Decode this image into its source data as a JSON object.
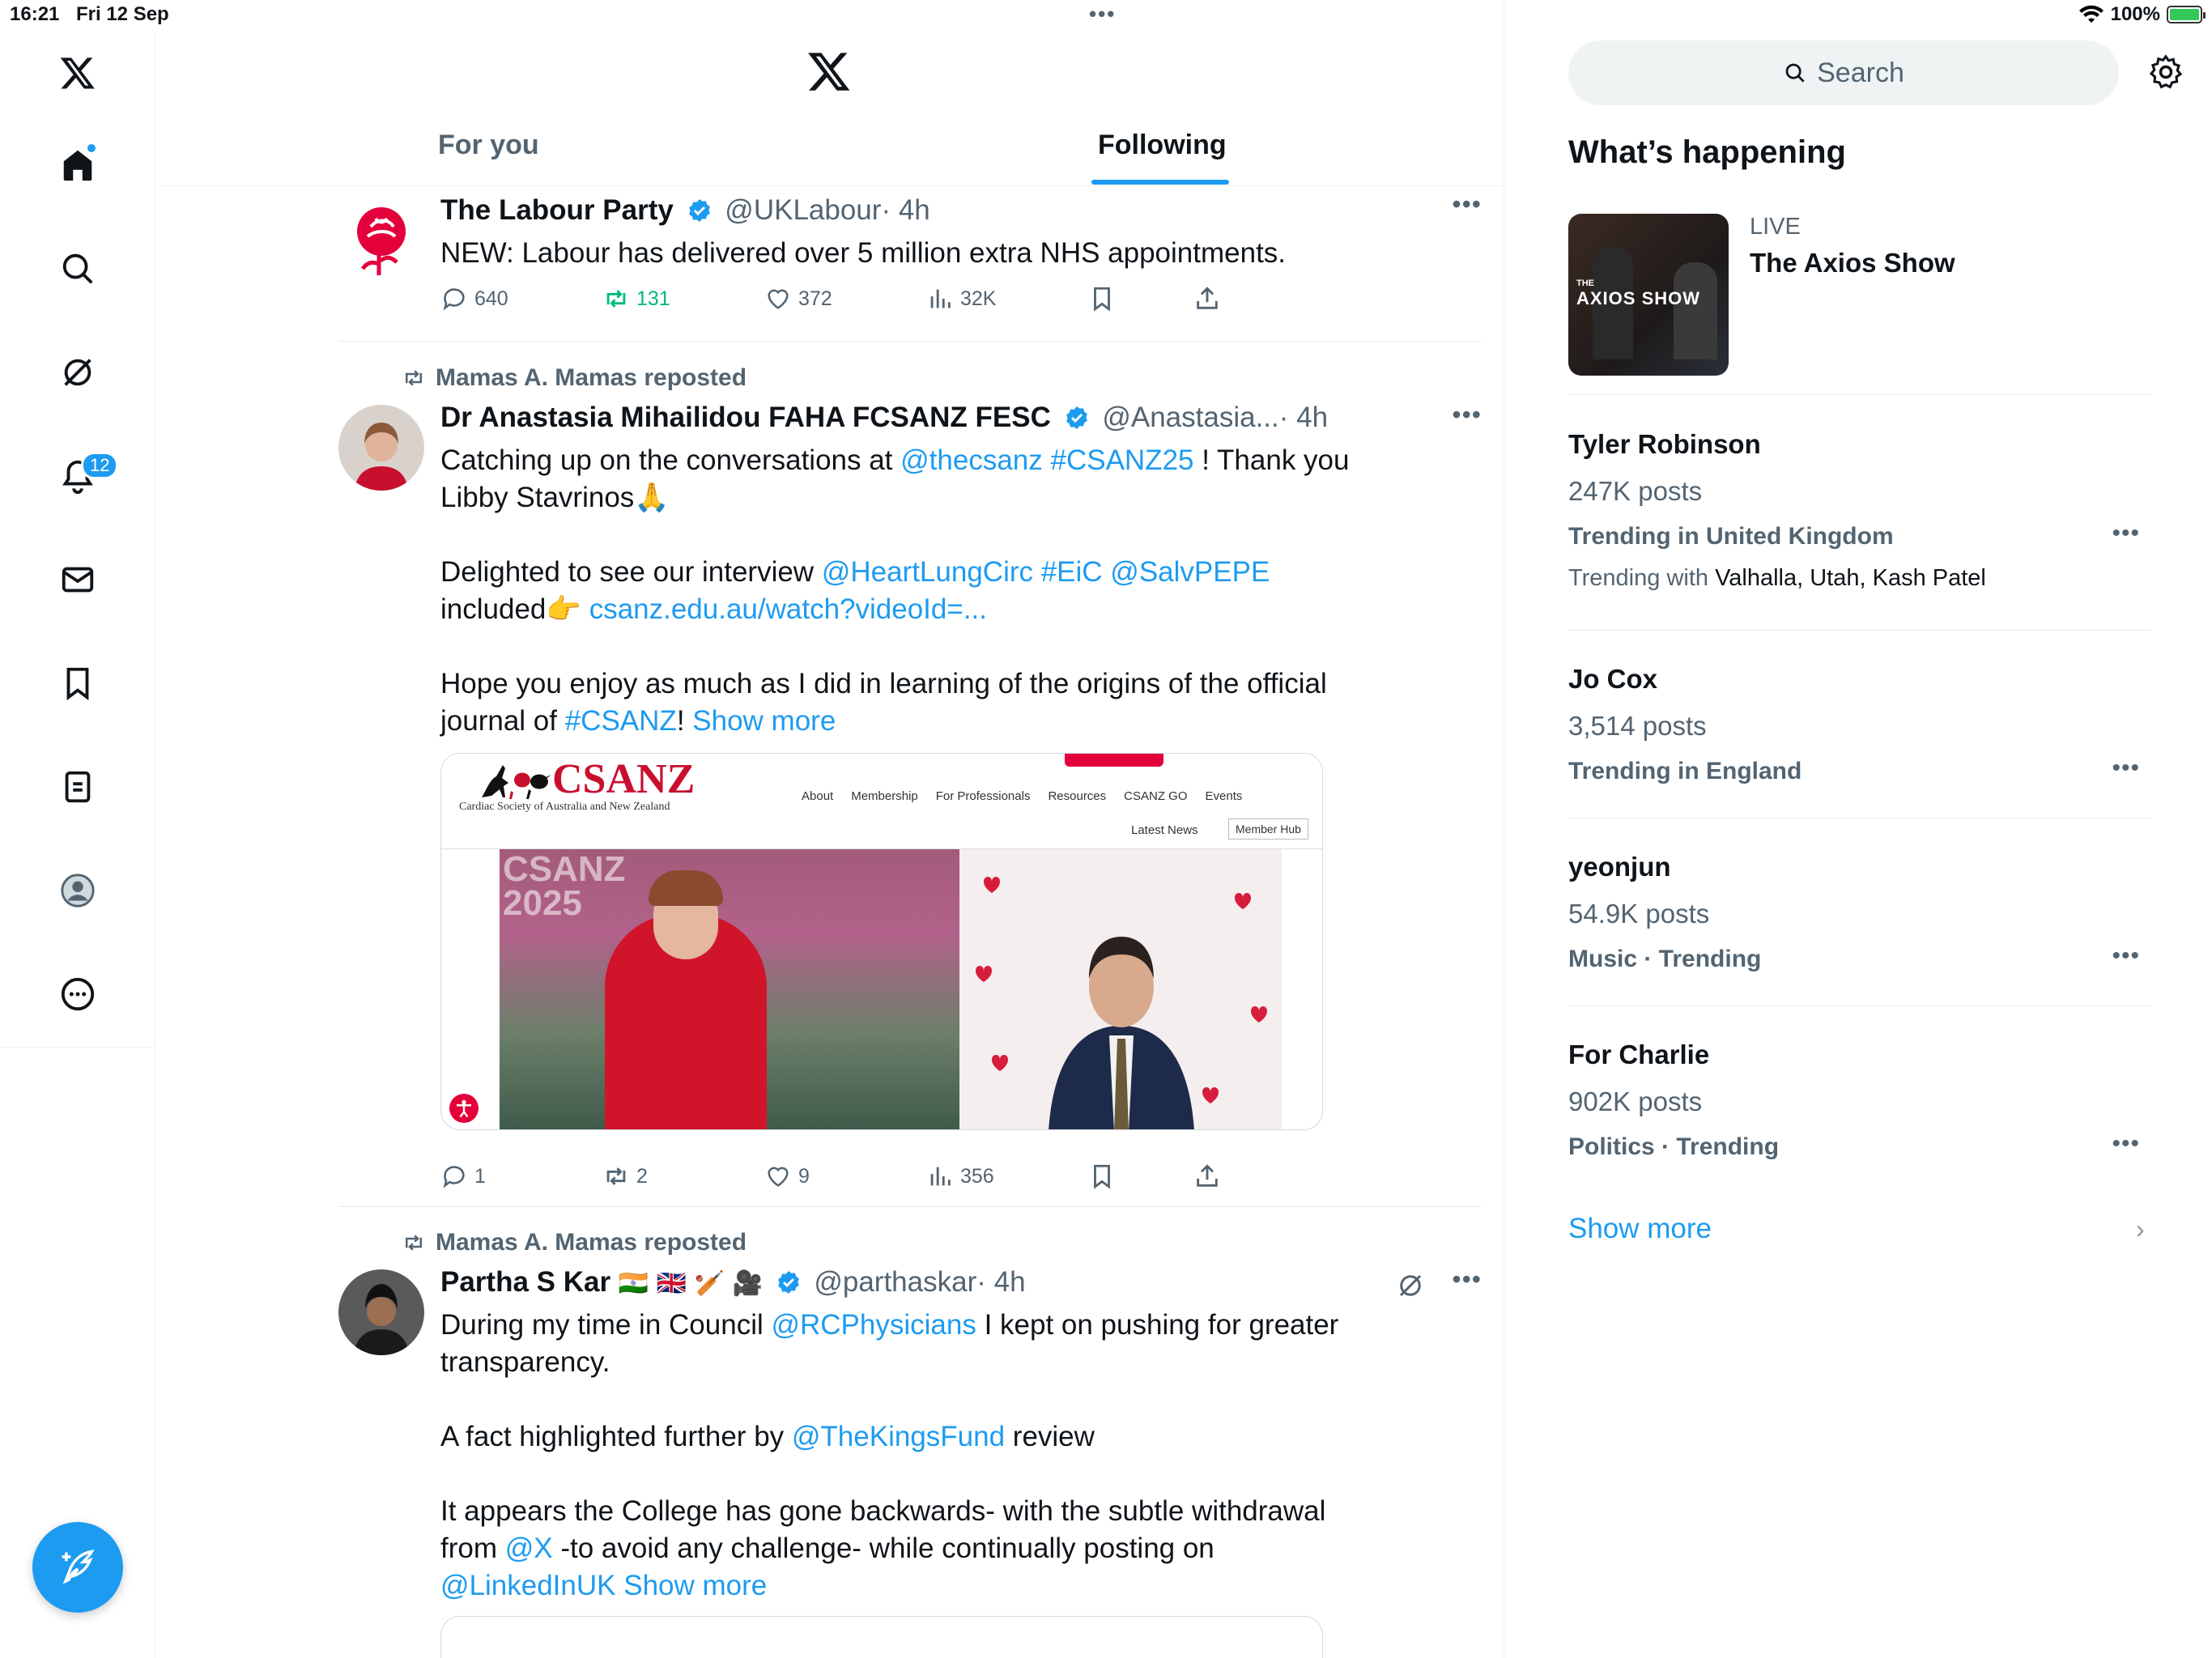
{
  "status": {
    "time": "16:21",
    "date": "Fri 12 Sep",
    "dots": "•••",
    "battery": "100%"
  },
  "nav": {
    "notifications_badge": "12"
  },
  "tabs": {
    "for_you": "For you",
    "following": "Following"
  },
  "posts": [
    {
      "name": "The Labour Party",
      "handle": "@UKLabour",
      "time": "· 4h",
      "text": "NEW: Labour has delivered over 5 million extra NHS appointments.",
      "replies": "640",
      "reposts": "131",
      "likes": "372",
      "views": "32K"
    },
    {
      "repost_by": "Mamas A. Mamas reposted",
      "name": "Dr Anastasia Mihailidou FAHA FCSANZ FESC",
      "handle": "@Anastasia...",
      "time": "· 4h",
      "text_1": "Catching up on the conversations at ",
      "link_1": "@thecsanz #CSANZ25",
      "text_2": " ! Thank you Libby Stavrinos🙏",
      "text_3": "Delighted to see our interview ",
      "link_2": "@HeartLungCirc #EiC @SalvPEPE",
      "text_4": " included👉 ",
      "link_3": "csanz.edu.au/watch?videoId=...",
      "text_5": "Hope you enjoy as much as I did in learning of the origins of the official journal of ",
      "link_4": "#CSANZ",
      "text_6": "! ",
      "show_more": "Show more",
      "replies": "1",
      "reposts": "2",
      "likes": "9",
      "views": "356",
      "media": {
        "logo": "CSANZ",
        "logo_sub": "Cardiac Society of Australia and New Zealand",
        "menu": [
          "About",
          "Membership",
          "For Professionals",
          "Resources",
          "CSANZ GO",
          "Events"
        ],
        "latest_news": "Latest News",
        "member_hub": "Member Hub",
        "backdrop_text": "CSANZ 2025"
      }
    },
    {
      "repost_by": "Mamas A. Mamas reposted",
      "name": "Partha S Kar",
      "emojis": "🇮🇳 🇬🇧 🏏 🎥",
      "handle": "@parthaskar",
      "time": "· 4h",
      "text_1": "During my time in Council ",
      "link_1": "@RCPhysicians",
      "text_2": " I kept on pushing for greater transparency.",
      "text_3": "A fact highlighted further by ",
      "link_2": "@TheKingsFund",
      "text_4": " review",
      "text_5": "It appears the College has gone backwards- with the subtle withdrawal from ",
      "link_3": "@X",
      "text_6": " -to avoid any challenge- while continually posting on",
      "link_4": "@LinkedInUK",
      "show_more": "Show more"
    }
  ],
  "right": {
    "search_placeholder": "Search",
    "whats_happening": "What’s happening",
    "live": {
      "label": "LIVE",
      "title": "The Axios Show",
      "thumb_text": "AXIOS SHOW",
      "thumb_small": "THE"
    },
    "trends": [
      {
        "title": "Tyler Robinson",
        "posts": "247K posts",
        "context": "Trending in United Kingdom",
        "with_label": "Trending with ",
        "with": "Valhalla, Utah, Kash Patel"
      },
      {
        "title": "Jo Cox",
        "posts": "3,514 posts",
        "context": "Trending in England"
      },
      {
        "title": "yeonjun",
        "posts": "54.9K posts",
        "context": "Music · Trending"
      },
      {
        "title": "For Charlie",
        "posts": "902K posts",
        "context": "Politics · Trending"
      }
    ],
    "show_more": "Show more"
  },
  "colors": {
    "accent": "#1d9bf0",
    "repost_green": "#00ba7c",
    "text": "#0f1419",
    "muted": "#536471"
  }
}
